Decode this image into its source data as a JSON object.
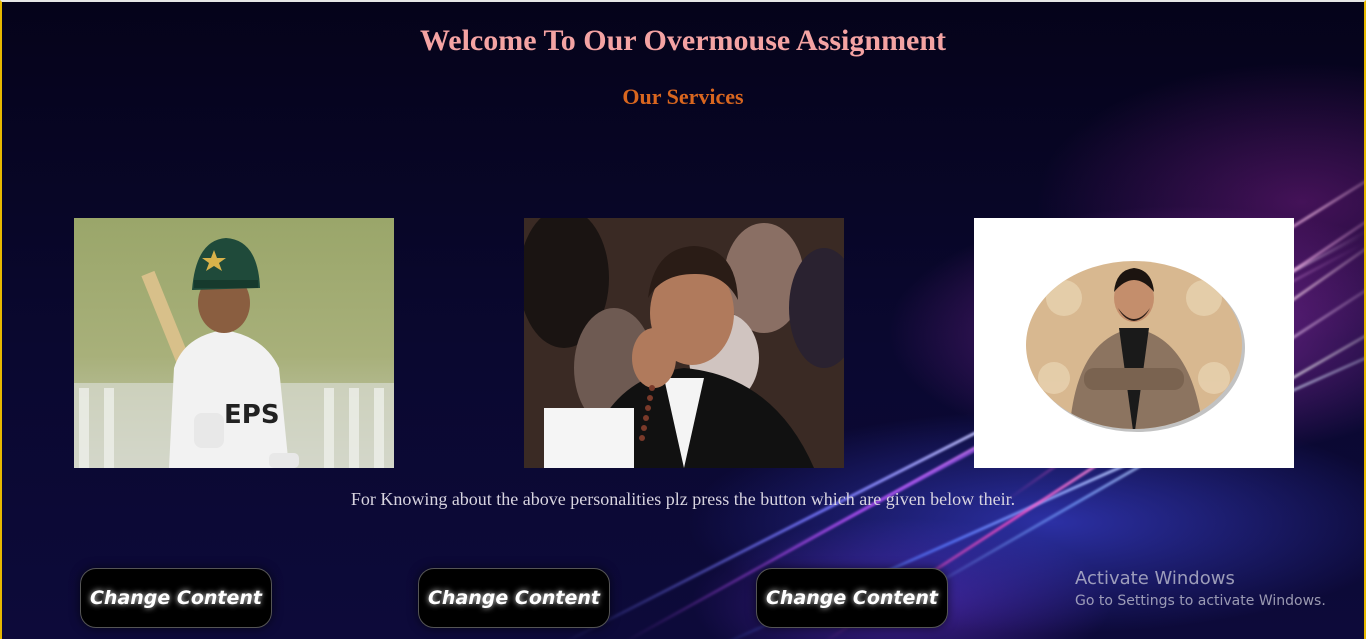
{
  "header": {
    "title": "Welcome To Our Overmouse Assignment",
    "subtitle": "Our Services"
  },
  "personalities": [
    {
      "image": "cricketer-photo"
    },
    {
      "image": "politician-photo"
    },
    {
      "image": "man-in-suit-oval-photo"
    }
  ],
  "caption": "For Knowing about the above personalities plz press the button which are given below their.",
  "buttons": [
    {
      "label": "Change Content"
    },
    {
      "label": "Change Content"
    },
    {
      "label": "Change Content"
    }
  ],
  "watermark": {
    "line1": "Activate Windows",
    "line2": "Go to Settings to activate Windows."
  },
  "colors": {
    "title": "#f4a3a3",
    "subtitle": "#d9661f",
    "background": "#07041c",
    "frame_border": "#e6b800"
  }
}
